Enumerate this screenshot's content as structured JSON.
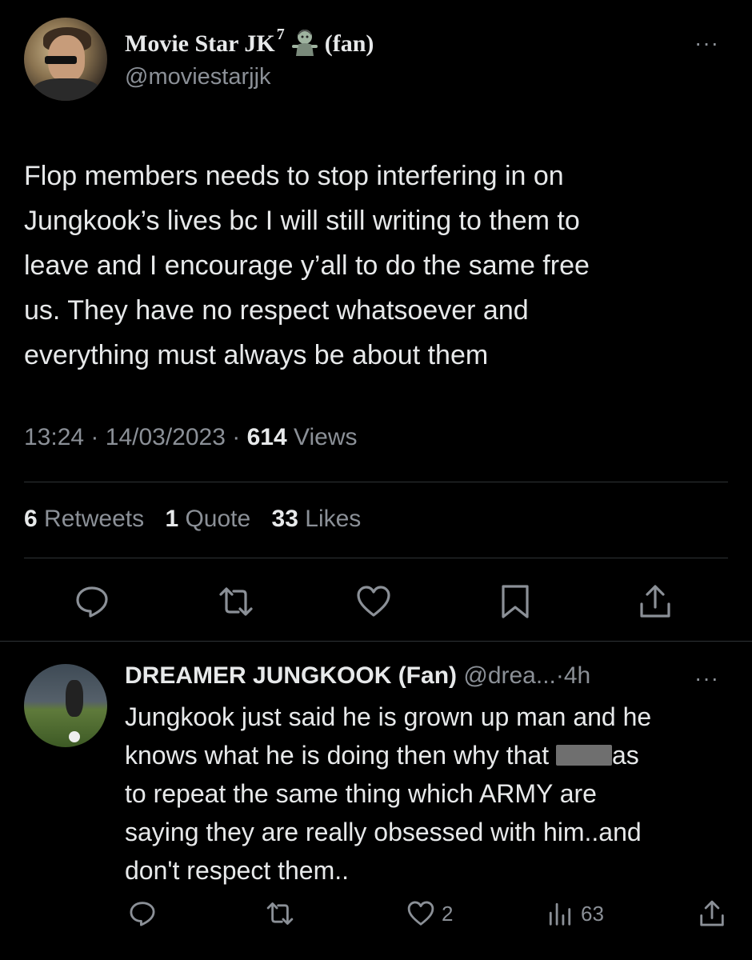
{
  "main_tweet": {
    "display_name": "Movie Star JK",
    "superscript": "7",
    "name_suffix": "(fan)",
    "handle": "@moviestarjjk",
    "more_label": "···",
    "text_lines": [
      "Flop members needs to stop interfering in on",
      "Jungkook’s lives bc I will still writing to them to",
      "leave and I encourage y’all to do the same free",
      "us. They have no respect whatsoever and",
      "everything must always be about them"
    ],
    "time": "13:24",
    "date": "14/03/2023",
    "views_count": "614",
    "views_label": "Views",
    "separator": "·",
    "retweets_count": "6",
    "retweets_label": "Retweets",
    "quotes_count": "1",
    "quotes_label": "Quote",
    "likes_count": "33",
    "likes_label": "Likes",
    "actions": [
      "reply-icon",
      "retweet-icon",
      "like-icon",
      "bookmark-icon",
      "share-icon"
    ]
  },
  "reply": {
    "display_name": "DREAMER JUNGKOOK (Fan)",
    "handle": "@drea...",
    "time": "4h",
    "more_label": "···",
    "text_line1": "Jungkook just said he is grown up man and he",
    "text_line2_before": "knows what he is doing then why that ",
    "text_line2_after": "as",
    "text_rest": "to repeat the same thing which ARMY are\nsaying they are really obsessed with him..and\ndon't respect them..",
    "likes_count": "2",
    "views_count": "63",
    "actions": [
      "reply-icon",
      "retweet-icon",
      "like-icon",
      "views-icon",
      "share-icon"
    ]
  },
  "colors": {
    "background": "#000000",
    "text": "#e7e9ea",
    "secondary": "#8b9097",
    "divider": "#2f3336"
  }
}
